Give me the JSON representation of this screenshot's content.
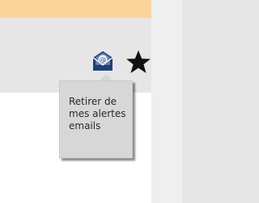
{
  "actions": {
    "email_alert_button": {
      "icon": "open-envelope-at-icon",
      "color": "#1f3f7a",
      "tooltip_text": "Retirer de mes alertes emails"
    },
    "favorite_button": {
      "icon": "star-icon",
      "color": "#111111"
    }
  },
  "theme": {
    "banner_color": "#fbd49b",
    "panel_background": "#e6e6e6",
    "content_background": "#ffffff",
    "tooltip_background": "#d7d7d7"
  }
}
